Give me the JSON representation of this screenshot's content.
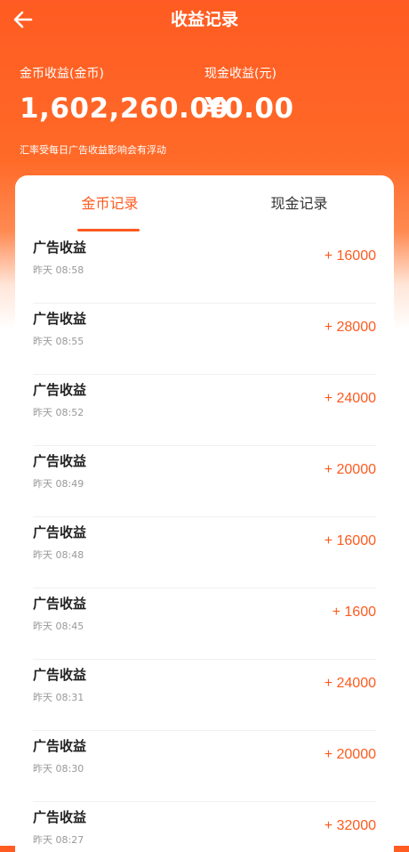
{
  "header": {
    "title": "收益记录"
  },
  "balance": {
    "coin_label": "金币收益(金币)",
    "coin_value": "1,602,260.00",
    "cash_label": "现金收益(元)",
    "cash_value": "¥0.00"
  },
  "note": "汇率受每日广告收益影响会有浮动",
  "tabs": [
    {
      "label": "金币记录",
      "active": true
    },
    {
      "label": "现金记录",
      "active": false
    }
  ],
  "records": [
    {
      "name": "广告收益",
      "time": "昨天 08:58",
      "amount": "+ 16000"
    },
    {
      "name": "广告收益",
      "time": "昨天 08:55",
      "amount": "+ 28000"
    },
    {
      "name": "广告收益",
      "time": "昨天 08:52",
      "amount": "+ 24000"
    },
    {
      "name": "广告收益",
      "time": "昨天 08:49",
      "amount": "+ 20000"
    },
    {
      "name": "广告收益",
      "time": "昨天 08:48",
      "amount": "+ 16000"
    },
    {
      "name": "广告收益",
      "time": "昨天 08:45",
      "amount": "+ 1600"
    },
    {
      "name": "广告收益",
      "time": "昨天 08:31",
      "amount": "+ 24000"
    },
    {
      "name": "广告收益",
      "time": "昨天 08:30",
      "amount": "+ 20000"
    },
    {
      "name": "广告收益",
      "time": "昨天 08:27",
      "amount": "+ 32000"
    }
  ]
}
